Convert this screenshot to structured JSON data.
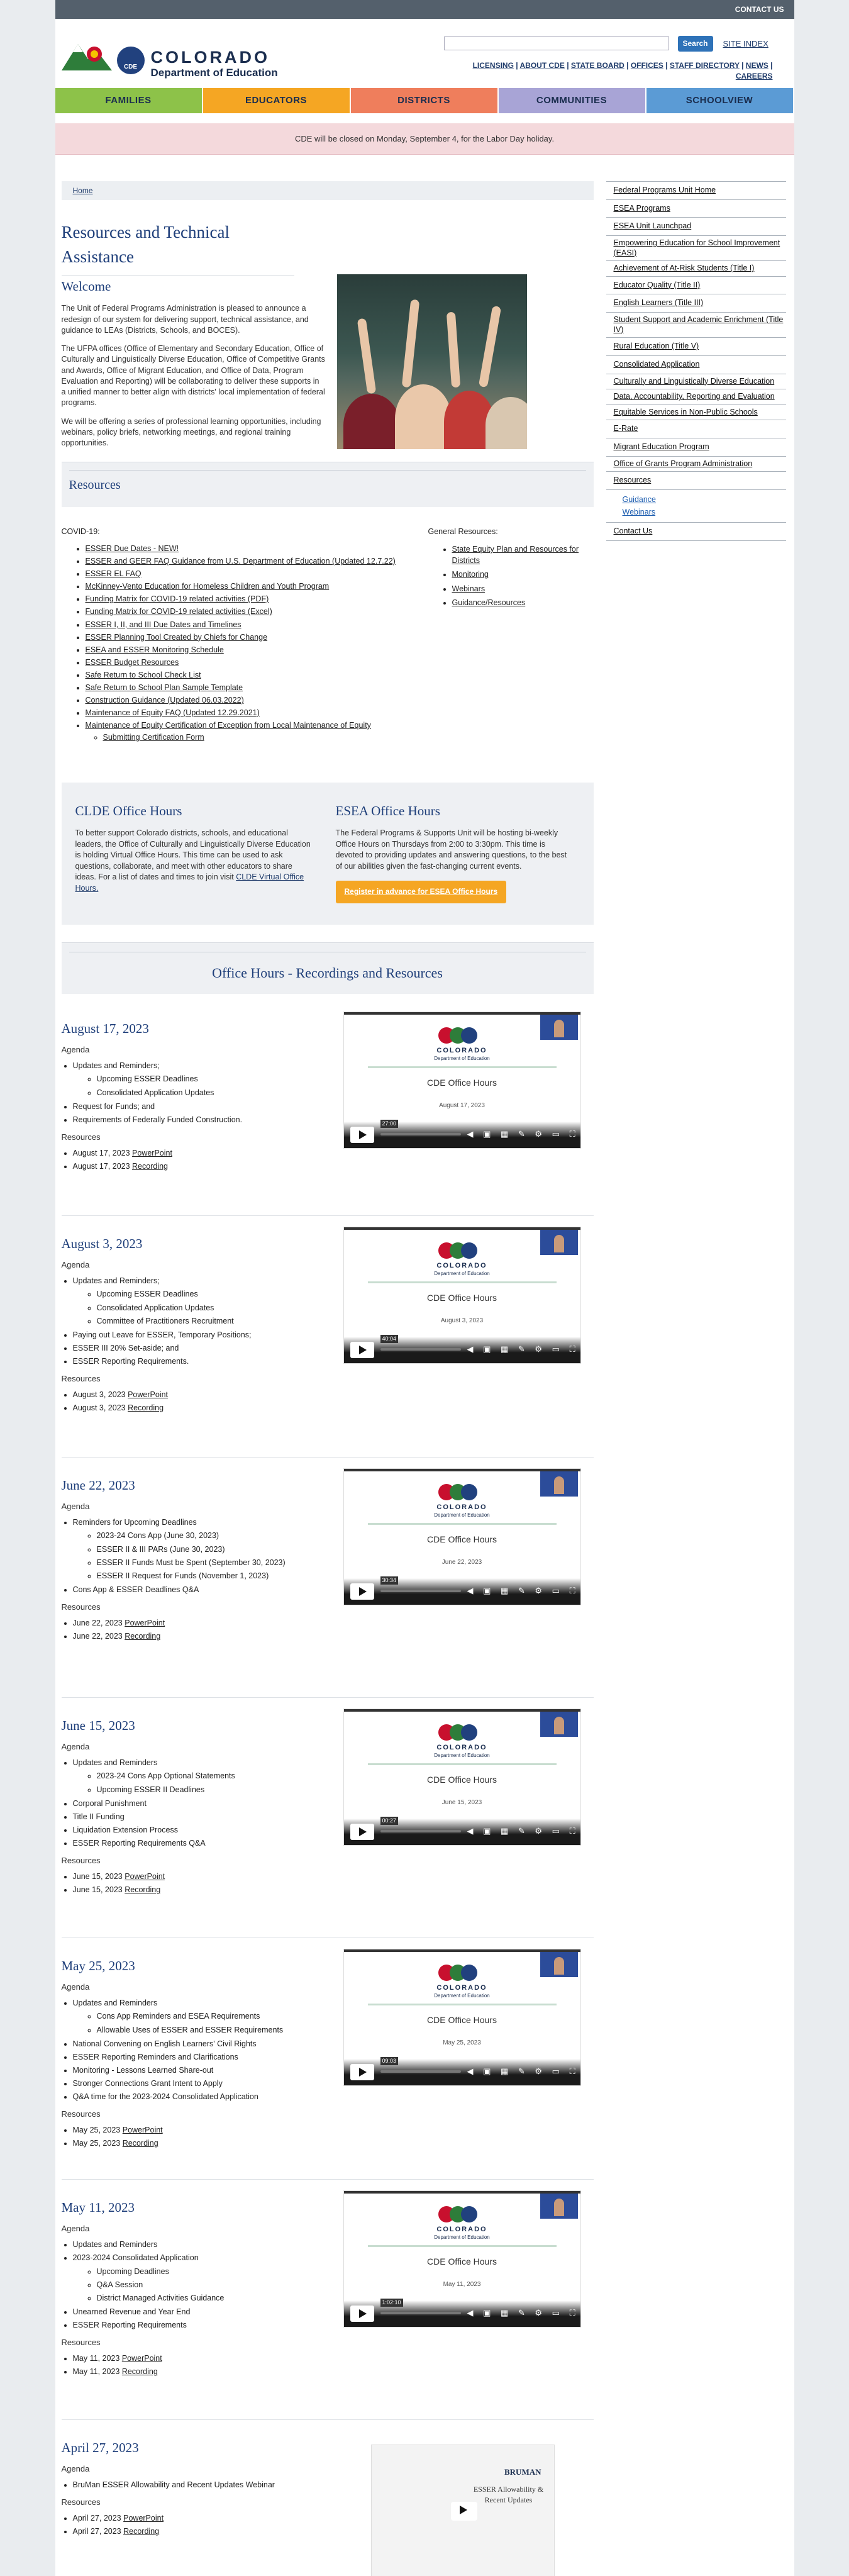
{
  "topbar": {
    "contact": "CONTACT US"
  },
  "header": {
    "logo_colorado": "COLORADO",
    "logo_dept": "Department of Education",
    "logo_badge": "CDE",
    "search_placeholder": "",
    "search_button": "Search",
    "site_index": "SITE INDEX",
    "util_links": [
      "LICENSING",
      "ABOUT CDE",
      "STATE BOARD",
      "OFFICES",
      "STAFF DIRECTORY",
      "NEWS",
      "CAREERS"
    ]
  },
  "nav": [
    {
      "label": "FAMILIES",
      "color": "#8dc249"
    },
    {
      "label": "EDUCATORS",
      "color": "#f5a623"
    },
    {
      "label": "DISTRICTS",
      "color": "#ef7e5c"
    },
    {
      "label": "COMMUNITIES",
      "color": "#a8a4d6"
    },
    {
      "label": "SCHOOLVIEW",
      "color": "#5b9bd5"
    }
  ],
  "alert": "CDE will be closed on Monday, September 4, for the Labor Day holiday.",
  "breadcrumb": "Home",
  "page_title": "Resources and Technical Assistance",
  "welcome": {
    "heading": "Welcome",
    "p1": "The Unit of Federal Programs Administration is pleased to announce a redesign of our system for delivering support, technical assistance, and guidance to LEAs (Districts, Schools, and BOCES).",
    "p2": "The UFPA offices (Office of Elementary and Secondary Education, Office of Culturally and Linguistically Diverse Education, Office of Competitive Grants and Awards, Office of Migrant Education, and Office of Data, Program Evaluation and Reporting) will be collaborating to deliver these supports in a unified manner to better align with districts' local implementation of federal programs.",
    "p3": "We will be offering a series of professional learning opportunities, including webinars, policy briefs, networking meetings, and regional training opportunities."
  },
  "resources_heading": "Resources",
  "covid": {
    "label": "COVID-19:",
    "items": [
      "ESSER Due Dates - NEW!",
      "ESSER and GEER FAQ Guidance from U.S. Department of Education (Updated 12.7.22)",
      "ESSER EL FAQ",
      "McKinney-Vento Education for Homeless Children and Youth Program",
      "Funding Matrix for COVID-19 related activities (PDF)",
      "Funding Matrix for COVID-19 related activities (Excel)",
      "ESSER I, II, and III Due Dates and Timelines",
      "ESSER Planning Tool Created by Chiefs for Change",
      "ESEA and ESSER Monitoring Schedule",
      "ESSER Budget Resources",
      "Safe Return to School Check List",
      "Safe Return to School Plan Sample Template",
      "Construction Guidance (Updated 06.03.2022)",
      "Maintenance of Equity FAQ (Updated 12.29.2021)",
      "Maintenance of Equity Certification of Exception from Local Maintenance of Equity"
    ],
    "sub_item": "Submitting Certification Form"
  },
  "general": {
    "label": "General Resources:",
    "items": [
      "State Equity Plan and Resources for Districts",
      "Monitoring",
      "Webinars",
      "Guidance/Resources"
    ]
  },
  "clde": {
    "heading": "CLDE Office Hours",
    "text": "To better support Colorado districts, schools, and educational leaders, the Office of Culturally and Linguistically Diverse Education is holding Virtual Office Hours. This time can be used to ask questions, collaborate, and meet with other educators to share ideas. For a list of dates and times to join visit",
    "link": "CLDE Virtual Office Hours."
  },
  "esea": {
    "heading": "ESEA Office Hours",
    "text": "The Federal Programs & Supports Unit will be hosting bi-weekly Office Hours on Thursdays from 2:00 to 3:30pm. This time is devoted to providing updates and answering questions, to the best of our abilities given the fast-changing current events.",
    "button": "Register in advance for ESEA Office Hours"
  },
  "office_hours_heading": "Office Hours - Recordings and Resources",
  "labels": {
    "agenda": "Agenda",
    "resources": "Resources",
    "powerpoint": "PowerPoint",
    "recording": "Recording",
    "video_title": "CDE Office Hours"
  },
  "sessions": [
    {
      "date": "August 17, 2023",
      "video_date": "August 17, 2023",
      "time": "27:00",
      "agenda": [
        {
          "t": "Updates and Reminders;",
          "sub": [
            "Upcoming ESSER Deadlines",
            "Consolidated Application Updates"
          ]
        },
        {
          "t": "Request for Funds; and"
        },
        {
          "t": "Requirements of Federally Funded Construction."
        }
      ],
      "res": [
        "August 17, 2023",
        "August 17, 2023"
      ]
    },
    {
      "date": "August 3, 2023",
      "video_date": "August 3, 2023",
      "time": "40:04",
      "agenda": [
        {
          "t": "Updates and Reminders;",
          "sub": [
            "Upcoming ESSER Deadlines",
            "Consolidated Application Updates",
            "Committee of Practitioners Recruitment"
          ]
        },
        {
          "t": "Paying out Leave for ESSER, Temporary Positions;"
        },
        {
          "t": "ESSER III 20% Set-aside; and"
        },
        {
          "t": "ESSER Reporting Requirements."
        }
      ],
      "res": [
        "August 3, 2023",
        "August 3, 2023"
      ]
    },
    {
      "date": "June 22, 2023",
      "video_date": "June 22, 2023",
      "time": "30:34",
      "agenda": [
        {
          "t": "Reminders for Upcoming Deadlines",
          "sub": [
            "2023-24 Cons App (June 30, 2023)",
            "ESSER II & III PARs (June 30, 2023)",
            "ESSER II Funds Must be Spent (September 30, 2023)",
            "ESSER II Request for Funds (November 1, 2023)"
          ]
        },
        {
          "t": "Cons App & ESSER Deadlines Q&A"
        }
      ],
      "res": [
        "June 22, 2023",
        "June 22, 2023"
      ]
    },
    {
      "date": "June 15, 2023",
      "video_date": "June 15, 2023",
      "time": "00:27",
      "agenda": [
        {
          "t": "Updates and Reminders",
          "sub": [
            "2023-24 Cons App Optional Statements",
            "Upcoming ESSER II Deadlines"
          ]
        },
        {
          "t": "Corporal Punishment"
        },
        {
          "t": "Title II Funding"
        },
        {
          "t": "Liquidation Extension Process"
        },
        {
          "t": "ESSER Reporting Requirements Q&A"
        }
      ],
      "res": [
        "June 15, 2023",
        "June 15, 2023"
      ]
    },
    {
      "date": "May 25, 2023",
      "video_date": "May 25, 2023",
      "time": "09:03",
      "agenda": [
        {
          "t": "Updates and Reminders",
          "sub": [
            "Cons App Reminders and ESEA Requirements",
            "Allowable Uses of ESSER and ESSER Requirements"
          ]
        },
        {
          "t": "National Convening on English Learners' Civil Rights"
        },
        {
          "t": "ESSER Reporting Reminders and Clarifications"
        },
        {
          "t": "Monitoring - Lessons Learned Share-out"
        },
        {
          "t": "Stronger Connections Grant Intent to Apply"
        },
        {
          "t": "Q&A time for the 2023-2024 Consolidated Application"
        }
      ],
      "res": [
        "May 25, 2023",
        "May 25, 2023"
      ]
    },
    {
      "date": "May 11, 2023",
      "video_date": "May 11, 2023",
      "time": "1:02:10",
      "agenda": [
        {
          "t": "Updates and Reminders"
        },
        {
          "t": "2023-2024 Consolidated Application",
          "sub": [
            "Upcoming Deadlines",
            "Q&A Session",
            "District Managed Activities Guidance"
          ]
        },
        {
          "t": "Unearned Revenue and Year End"
        },
        {
          "t": "ESSER Reporting Requirements"
        }
      ],
      "res": [
        "May 11, 2023",
        "May 11, 2023"
      ]
    },
    {
      "date": "April 27, 2023",
      "video_date": "",
      "time": "",
      "agenda": [
        {
          "t": "BruMan ESSER Allowability and Recent Updates Webinar"
        }
      ],
      "res": [
        "April 27, 2023",
        "April 27, 2023"
      ]
    }
  ],
  "book_video": {
    "brand": "BRUMAN",
    "title": "ESSER Allowability & Recent Updates"
  },
  "sidebar": {
    "items": [
      "Federal Programs Unit Home",
      "ESEA Programs",
      "ESEA Unit Launchpad",
      "Empowering Education for School Improvement (EASI)",
      "Achievement of At-Risk Students (Title I)",
      "Educator Quality (Title II)",
      "English Learners (Title III)",
      "Student Support and Academic Enrichment (Title IV)",
      "Rural Education (Title V)",
      "Consolidated Application",
      "Culturally and Linguistically Diverse Education",
      "Data, Accountability, Reporting and Evaluation",
      "Equitable Services in Non-Public Schools",
      "E-Rate",
      "Migrant Education Program",
      "Office of Grants Program Administration",
      "Resources"
    ],
    "sub": [
      "Guidance",
      "Webinars"
    ],
    "last": "Contact Us"
  }
}
